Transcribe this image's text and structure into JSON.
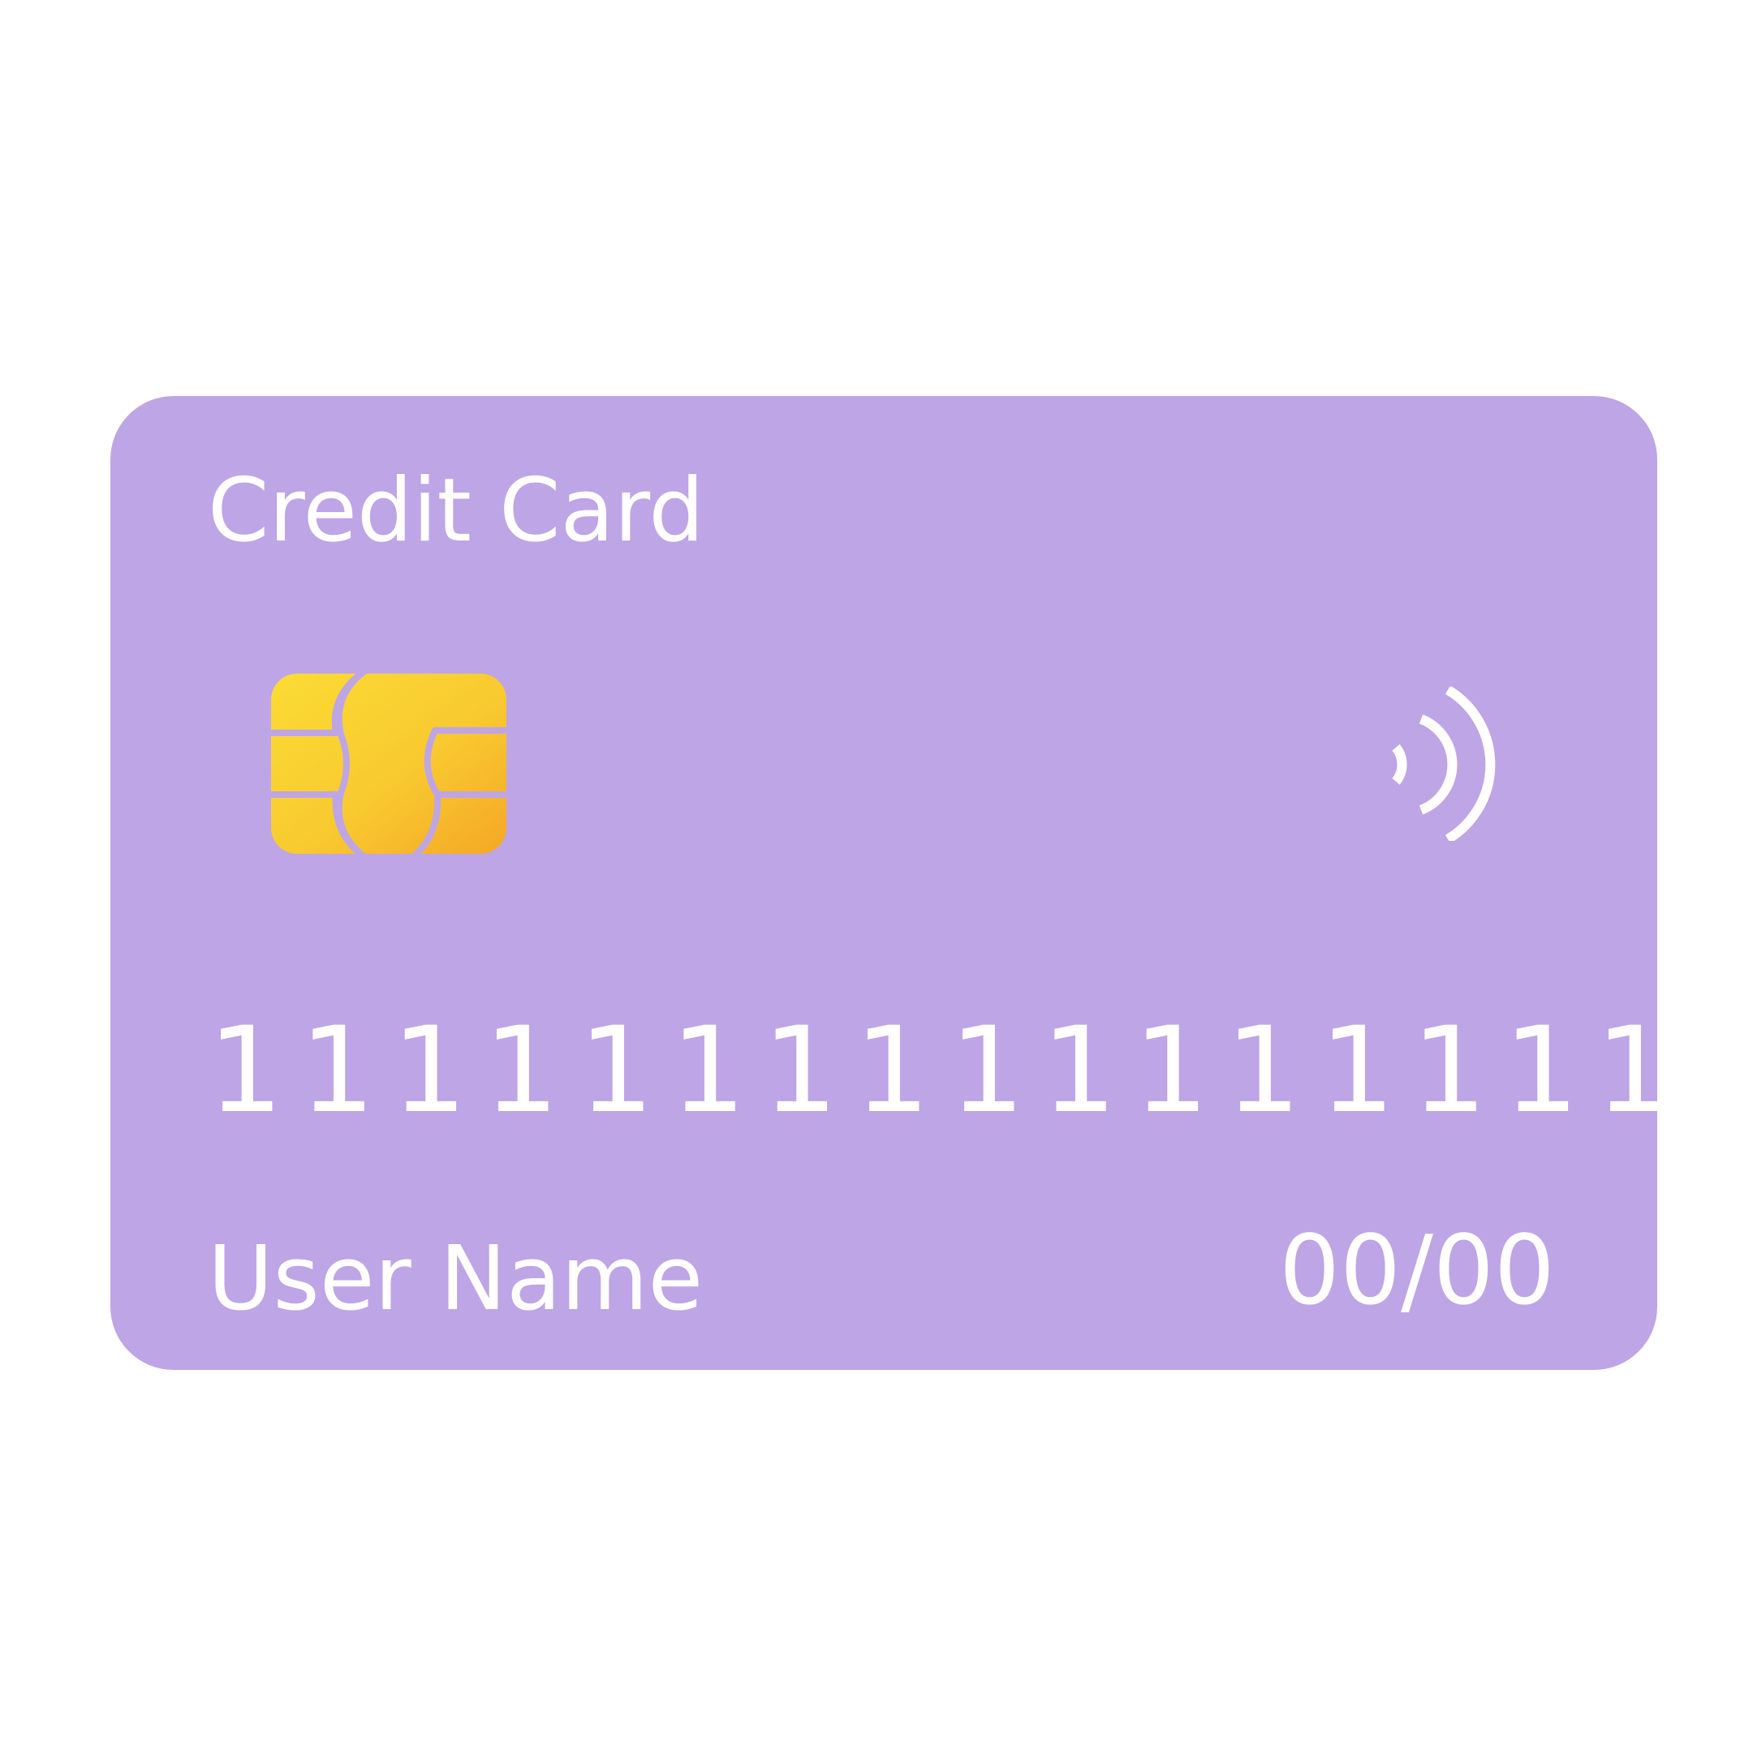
{
  "card": {
    "title": "Credit Card",
    "number_groups": [
      "1111",
      "1111",
      "1111",
      "1111"
    ],
    "holder_name": "User Name",
    "expiry": "00/00",
    "chip_icon": "chip-icon",
    "contactless_icon": "contactless-icon"
  },
  "colors": {
    "background": "#ffffff",
    "card_background": "#bea5e6",
    "text": "#ffffff",
    "chip_gradient_start": "#fbdc34",
    "chip_gradient_end": "#f5a726"
  }
}
